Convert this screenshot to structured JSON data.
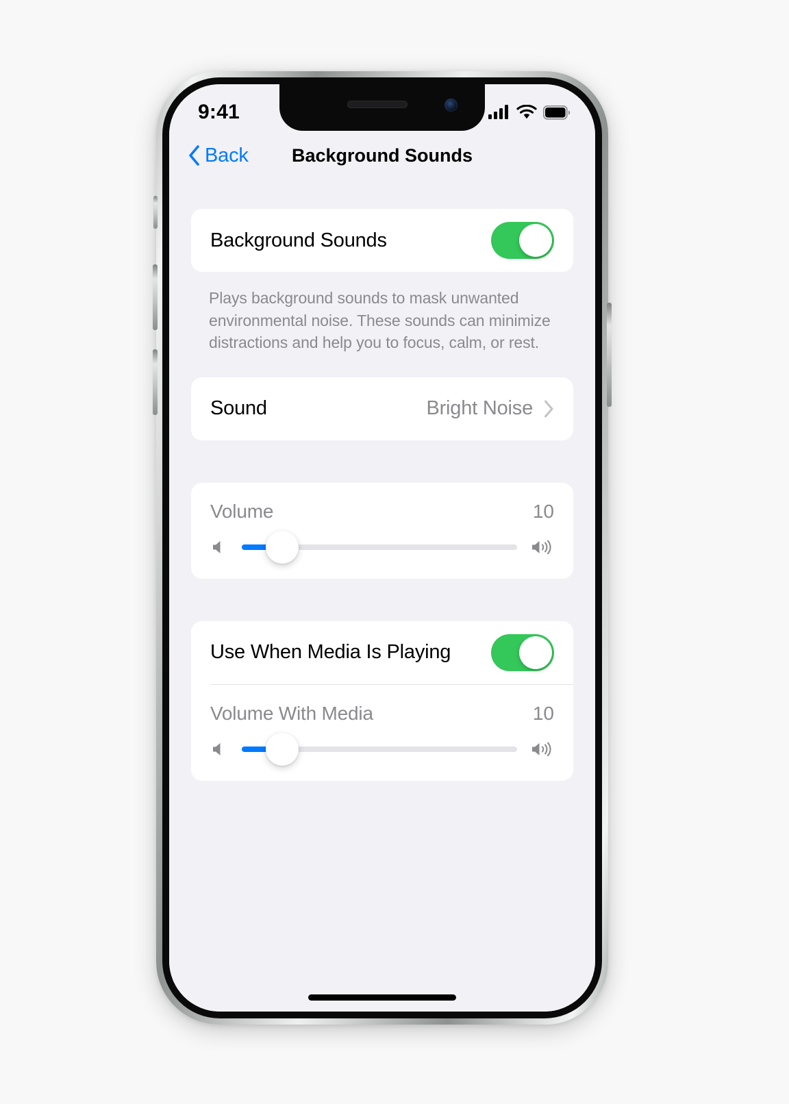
{
  "status_bar": {
    "time": "9:41",
    "cellular_icon": "cellular-bars-icon",
    "wifi_icon": "wifi-icon",
    "battery_icon": "battery-full-icon"
  },
  "nav": {
    "back_label": "Back",
    "back_icon": "chevron-left-icon",
    "title": "Background Sounds"
  },
  "sections": {
    "main_toggle": {
      "label": "Background Sounds",
      "enabled": true
    },
    "description": "Plays background sounds to mask unwanted environmental noise. These sounds can minimize distractions and help you to focus, calm, or rest.",
    "sound_row": {
      "label": "Sound",
      "value": "Bright Noise",
      "chevron_icon": "chevron-right-icon"
    },
    "volume": {
      "label": "Volume",
      "value": "10",
      "percent": 10,
      "low_icon": "speaker-low-icon",
      "high_icon": "speaker-high-icon"
    },
    "media_toggle": {
      "label": "Use When Media Is Playing",
      "enabled": true
    },
    "volume_with_media": {
      "label": "Volume With Media",
      "value": "10",
      "percent": 10,
      "low_icon": "speaker-low-icon",
      "high_icon": "speaker-high-icon"
    }
  },
  "colors": {
    "accent_blue": "#007AFF",
    "toggle_green": "#34C759",
    "background": "#F2F1F6",
    "card": "#FFFFFF",
    "secondary_text": "#8A8A8E"
  }
}
